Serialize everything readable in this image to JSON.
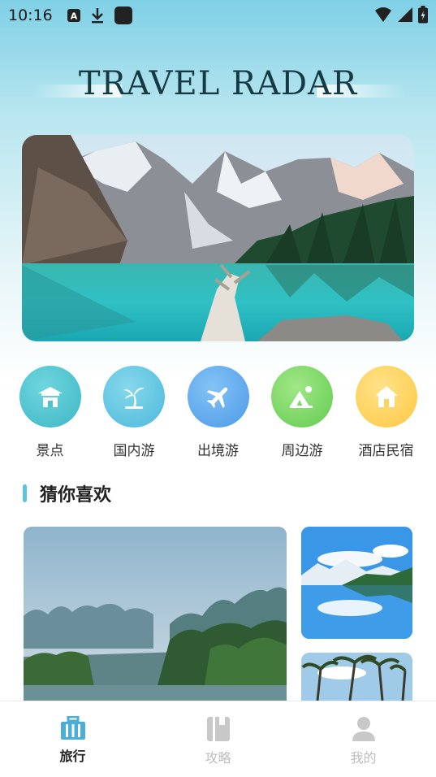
{
  "status_bar": {
    "time": "10:16",
    "left_icons": [
      "a-notification-icon",
      "download-icon",
      "app-square-icon"
    ],
    "right_icons": [
      "wifi-icon",
      "signal-icon",
      "battery-icon"
    ]
  },
  "brand": {
    "title": "TRAVEL RADAR"
  },
  "hero": {
    "image": "mountain-lake-photo"
  },
  "categories": [
    {
      "label": "景点",
      "icon": "temple-icon",
      "color": "#4cc3cf"
    },
    {
      "label": "国内游",
      "icon": "palm-tree-icon",
      "color": "#5cc7e2"
    },
    {
      "label": "出境游",
      "icon": "airplane-icon",
      "color": "#5aa8ef"
    },
    {
      "label": "周边游",
      "icon": "mountain-icon",
      "color": "#7fd96a"
    },
    {
      "label": "酒店民宿",
      "icon": "house-icon",
      "color": "#ffd45e"
    }
  ],
  "section": {
    "title": "猜你喜欢"
  },
  "cards": [
    {
      "image": "karst-river-photo"
    },
    {
      "image": "lake-reflection-photo"
    },
    {
      "image": "palm-trees-photo"
    }
  ],
  "bottom_nav": {
    "active_color": "#4aaed8",
    "inactive_color": "#c8c8c8",
    "items": [
      {
        "label": "旅行",
        "icon": "luggage-icon",
        "active": true
      },
      {
        "label": "攻略",
        "icon": "book-icon",
        "active": false
      },
      {
        "label": "我的",
        "icon": "user-icon",
        "active": false
      }
    ]
  }
}
